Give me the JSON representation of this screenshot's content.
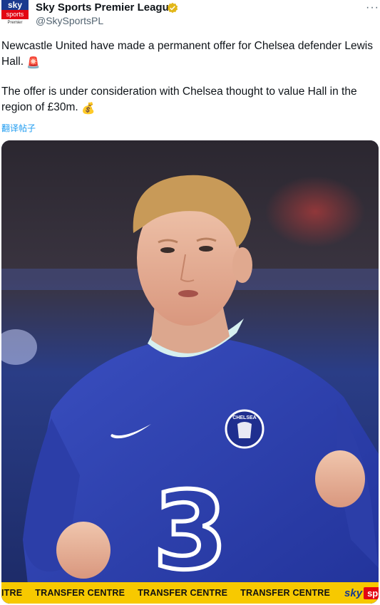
{
  "author": {
    "avatar": {
      "line1": "sky",
      "line2": "sports",
      "line3": "Premier League"
    },
    "display_name": "Sky Sports Premier League",
    "handle": "@SkySportsPL"
  },
  "more_label": "···",
  "tweet": {
    "paragraph1": "Newcastle United have made a permanent offer for Chelsea defender Lewis Hall.",
    "paragraph2": "The offer is under consideration with Chelsea thought to value Hall in the region of £30m.",
    "emoji1": "🚨",
    "emoji2": "💰"
  },
  "translate_label": "翻译帖子",
  "media": {
    "crest_text": "CHELSEA",
    "shirt_number": "3",
    "banner_items": [
      "ITRE",
      "TRANSFER CENTRE",
      "TRANSFER CENTRE",
      "TRANSFER CENTRE"
    ],
    "banner_logo_sky": "sky",
    "banner_logo_sports": "sports"
  },
  "colors": {
    "chelsea_blue": "#2a3fa8",
    "banner_yellow": "#f7c900",
    "sky_red": "#e30613",
    "link_blue": "#1d9bf0"
  }
}
